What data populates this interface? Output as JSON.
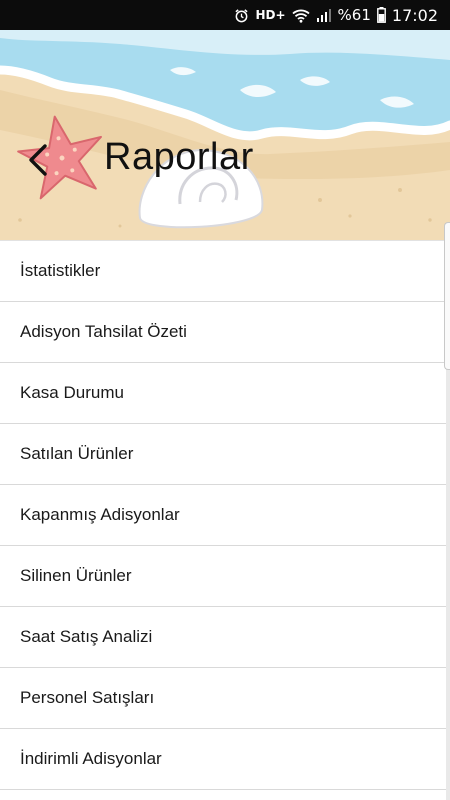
{
  "status_bar": {
    "icons": [
      "alarm-icon",
      "wifi-icon",
      "signal-icon",
      "battery-icon"
    ],
    "hd_label": "HD+",
    "battery": "%61",
    "time": "17:02"
  },
  "header": {
    "title": "Raporlar",
    "back_icon": "chevron-left-icon",
    "background": "beach-illustration"
  },
  "menu": {
    "items": [
      {
        "label": "İstatistikler"
      },
      {
        "label": "Adisyon Tahsilat Özeti"
      },
      {
        "label": "Kasa Durumu"
      },
      {
        "label": "Satılan Ürünler"
      },
      {
        "label": "Kapanmış Adisyonlar"
      },
      {
        "label": "Silinen Ürünler"
      },
      {
        "label": "Saat Satış Analizi"
      },
      {
        "label": "Personel Satışları"
      },
      {
        "label": "İndirimli Adisyonlar"
      }
    ]
  },
  "colors": {
    "sand": "#f0dcb8",
    "sea": "#a9dcee",
    "starfish": "#ef8a8e"
  }
}
